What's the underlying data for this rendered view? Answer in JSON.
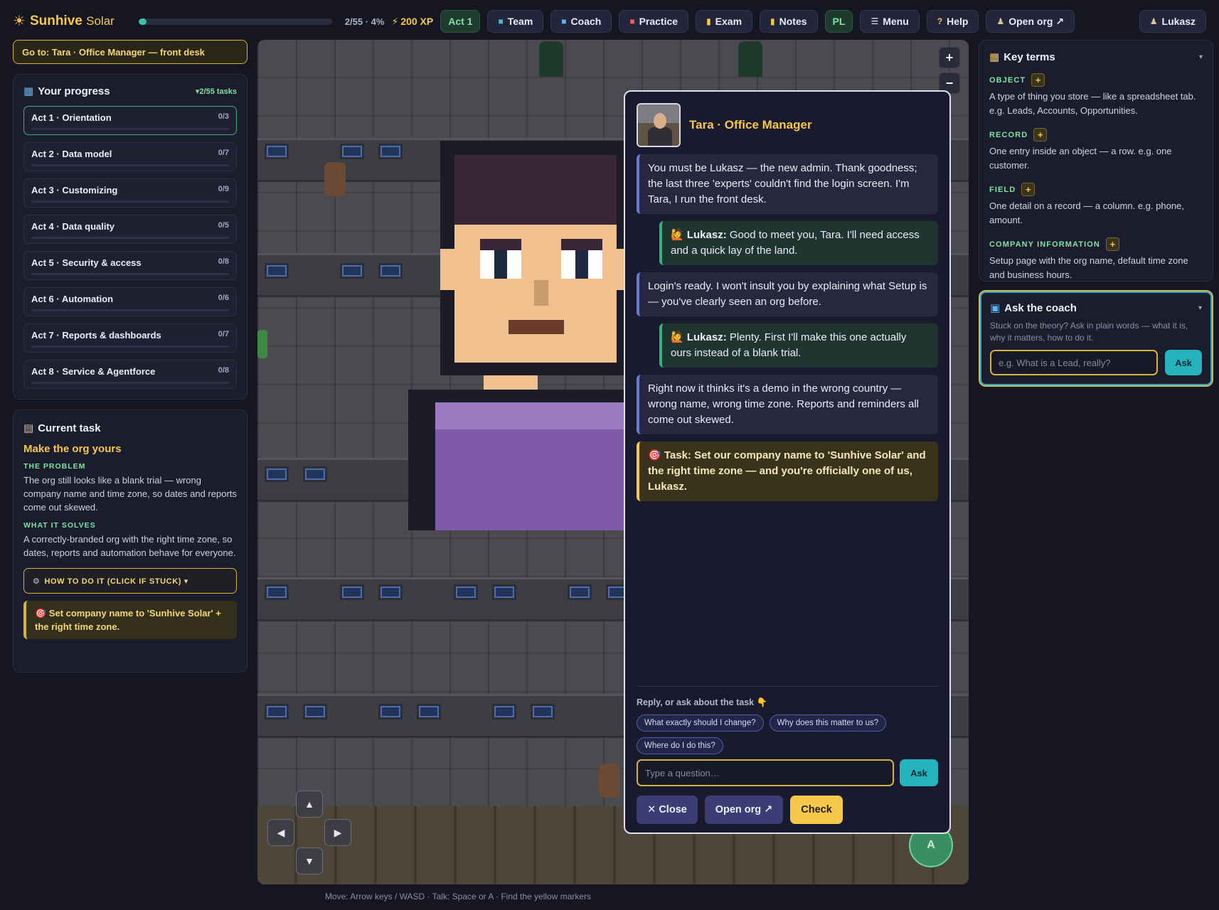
{
  "topbar": {
    "brand_icon": "sun-icon",
    "brand_first": "Sunhive",
    "brand_second": "Solar",
    "progress_text": "2/55 · 4%",
    "progress_value": 0.04,
    "xp": "200 XP",
    "act": "Act 1",
    "nav": {
      "team": "Team",
      "coach": "Coach",
      "practice": "Practice",
      "exam": "Exam",
      "notes": "Notes",
      "lang": "PL",
      "menu": "Menu",
      "help": "Help",
      "open_org": "Open org ↗",
      "user": "Lukasz"
    }
  },
  "goto": "Go to: Tara · Office Manager — front desk",
  "progress_panel": {
    "title": "Your progress",
    "count": "▾2/55 tasks",
    "acts": [
      {
        "label": "Act 1 · Orientation",
        "count": "0/3"
      },
      {
        "label": "Act 2 · Data model",
        "count": "0/7"
      },
      {
        "label": "Act 3 · Customizing",
        "count": "0/9"
      },
      {
        "label": "Act 4 · Data quality",
        "count": "0/5"
      },
      {
        "label": "Act 5 · Security & access",
        "count": "0/8"
      },
      {
        "label": "Act 6 · Automation",
        "count": "0/6"
      },
      {
        "label": "Act 7 · Reports & dashboards",
        "count": "0/7"
      },
      {
        "label": "Act 8 · Service & Agentforce",
        "count": "0/8"
      }
    ]
  },
  "task_panel": {
    "title": "Current task",
    "name": "Make the org yours",
    "problem_label": "THE PROBLEM",
    "problem": "The org still looks like a blank trial — wrong company name and time zone, so dates and reports come out skewed.",
    "solves_label": "WHAT IT SOLVES",
    "solves": "A correctly-branded org with the right time zone, so dates, reports and automation behave for everyone.",
    "howto": "HOW TO DO IT (CLICK IF STUCK) ▾",
    "goal": "🎯 Set company name to 'Sunhive Solar' + the right time zone."
  },
  "dialog": {
    "name": "Tara · Office Manager",
    "messages": [
      {
        "who": "npc",
        "text": "You must be Lukasz — the new admin. Thank goodness; the last three 'experts' couldn't find the login screen. I'm Tara, I run the front desk."
      },
      {
        "who": "me",
        "speaker": "🙋 Lukasz:",
        "text": "Good to meet you, Tara. I'll need access and a quick lay of the land."
      },
      {
        "who": "npc",
        "text": "Login's ready. I won't insult you by explaining what Setup is — you've clearly seen an org before."
      },
      {
        "who": "me",
        "speaker": "🙋 Lukasz:",
        "text": "Plenty. First I'll make this one actually ours instead of a blank trial."
      },
      {
        "who": "npc",
        "text": "Right now it thinks it's a demo in the wrong country — wrong name, wrong time zone. Reports and reminders all come out skewed."
      },
      {
        "who": "task",
        "speaker": "🎯 Task:",
        "text": "Set our company name to 'Sunhive Solar' and the right time zone — and you're officially one of us, Lukasz."
      }
    ],
    "reply_label": "Reply, or ask about the task 👇",
    "chips": [
      "What exactly should I change?",
      "Why does this matter to us?",
      "Where do I do this?"
    ],
    "input_placeholder": "Type a question…",
    "ask": "Ask",
    "close": "✕ Close",
    "open_org": "Open org ↗",
    "check": "Check"
  },
  "key_terms": {
    "title": "Key terms",
    "terms": [
      {
        "name": "OBJECT",
        "def": "A type of thing you store — like a spreadsheet tab. e.g. Leads, Accounts, Opportunities."
      },
      {
        "name": "RECORD",
        "def": "One entry inside an object — a row. e.g. one customer."
      },
      {
        "name": "FIELD",
        "def": "One detail on a record — a column. e.g. phone, amount."
      },
      {
        "name": "COMPANY INFORMATION",
        "def": "Setup page with the org name, default time zone and business hours."
      }
    ]
  },
  "coach": {
    "title": "Ask the coach",
    "subtitle": "Stuck on the theory? Ask in plain words — what it is, why it matters, how to do it.",
    "placeholder": "e.g. What is a Lead, really?",
    "ask": "Ask"
  },
  "map": {
    "zoom_in": "+",
    "zoom_out": "−",
    "dpad": {
      "up": "▲",
      "left": "◀",
      "right": "▶",
      "down": "▼"
    },
    "action": "A"
  },
  "footer": "Move: Arrow keys / WASD · Talk: Space or A · Find the yellow markers"
}
